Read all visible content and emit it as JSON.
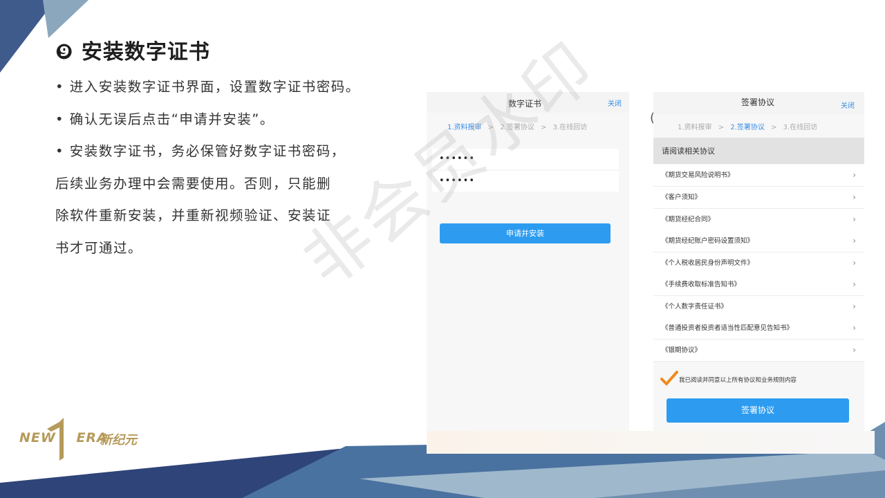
{
  "slide": {
    "title": "❾ 安装数字证书",
    "bullets": [
      "• 进入安装数字证书界面，设置数字证书密码。",
      "• 确认无误后点击“申请并安装”。",
      "• 安装数字证书，务必保管好数字证书密码，",
      "后续业务办理中会需要使用。否则，只能删",
      "除软件重新安装，并重新视频验证、安装证",
      "书才可通过。"
    ]
  },
  "logo": {
    "text": "NEW ERA",
    "cn": "新纪元",
    "color": "#b69a5a"
  },
  "watermark": "非会员水印",
  "screen1": {
    "title": "数字证书",
    "close": "关闭",
    "steps": [
      "1.资料报审",
      ">",
      "2.签署协议",
      ">",
      "3.在线回访"
    ],
    "password1": "••••••",
    "password2": "••••••",
    "button": "申请并安装"
  },
  "screen2": {
    "title": "签署协议",
    "close": "关闭",
    "steps": [
      "1.资料报审",
      ">",
      "2.签署协议",
      ">",
      "3.在线回访"
    ],
    "section_header": "请阅读相关协议",
    "agreements": [
      "《期货交易风险说明书》",
      "《客户须知》",
      "《期货经纪合同》",
      "《期货经纪账户密码设置须知》",
      "《个人税收居民身份声明文件》",
      "《手续费收取标准告知书》",
      "《个人数字责任证书》",
      "《普通投资者投资者适当性匹配意见告知书》",
      "《银期协议》"
    ],
    "confirm_text": "我已阅读并同意以上所有协议和业务规则内容",
    "button": "签署协议"
  },
  "colors": {
    "accent_blue": "#2d9cf0",
    "deco_dark": "#3f5b8c",
    "deco_light": "#9fb8cc"
  }
}
